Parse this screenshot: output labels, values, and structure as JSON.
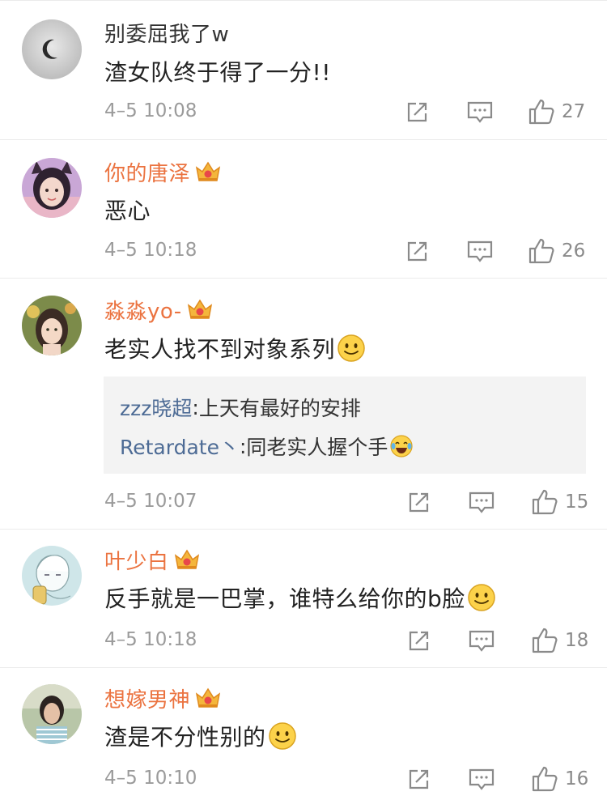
{
  "comments": [
    {
      "username": "别委屈我了w",
      "vip": false,
      "text": "渣女队终于得了一分!!",
      "emoji": false,
      "time": "4–5 10:08",
      "likes": "27"
    },
    {
      "username": "你的唐泽",
      "vip": true,
      "text": "恶心",
      "emoji": false,
      "time": "4–5 10:18",
      "likes": "26"
    },
    {
      "username": "淼淼yo-",
      "vip": true,
      "text": "老实人找不到对象系列",
      "emoji": true,
      "time": "4–5 10:07",
      "likes": "15",
      "replies": [
        {
          "name": "zzz晓超",
          "separator": ": ",
          "text": "上天有最好的安排"
        },
        {
          "name": "Retardate丶",
          "separator": ": ",
          "text": "同老实人握个手"
        }
      ]
    },
    {
      "username": "叶少白",
      "vip": true,
      "text": "反手就是一巴掌，谁特么给你的b脸",
      "emoji": true,
      "time": "4–5 10:18",
      "likes": "18"
    },
    {
      "username": "想嫁男神",
      "vip": true,
      "text": "渣是不分性别的",
      "emoji": true,
      "time": "4–5 10:10",
      "likes": "16"
    }
  ],
  "icons": {
    "share": "share-icon",
    "comment": "comment-icon",
    "like": "thumbs-up-icon",
    "vip": "crown-icon",
    "smile": "smile-emoji",
    "laugh": "laugh-cry-emoji"
  },
  "colors": {
    "vip_name": "#eb7340",
    "reply_name": "#4d6b95",
    "meta": "#9b9b9b"
  }
}
